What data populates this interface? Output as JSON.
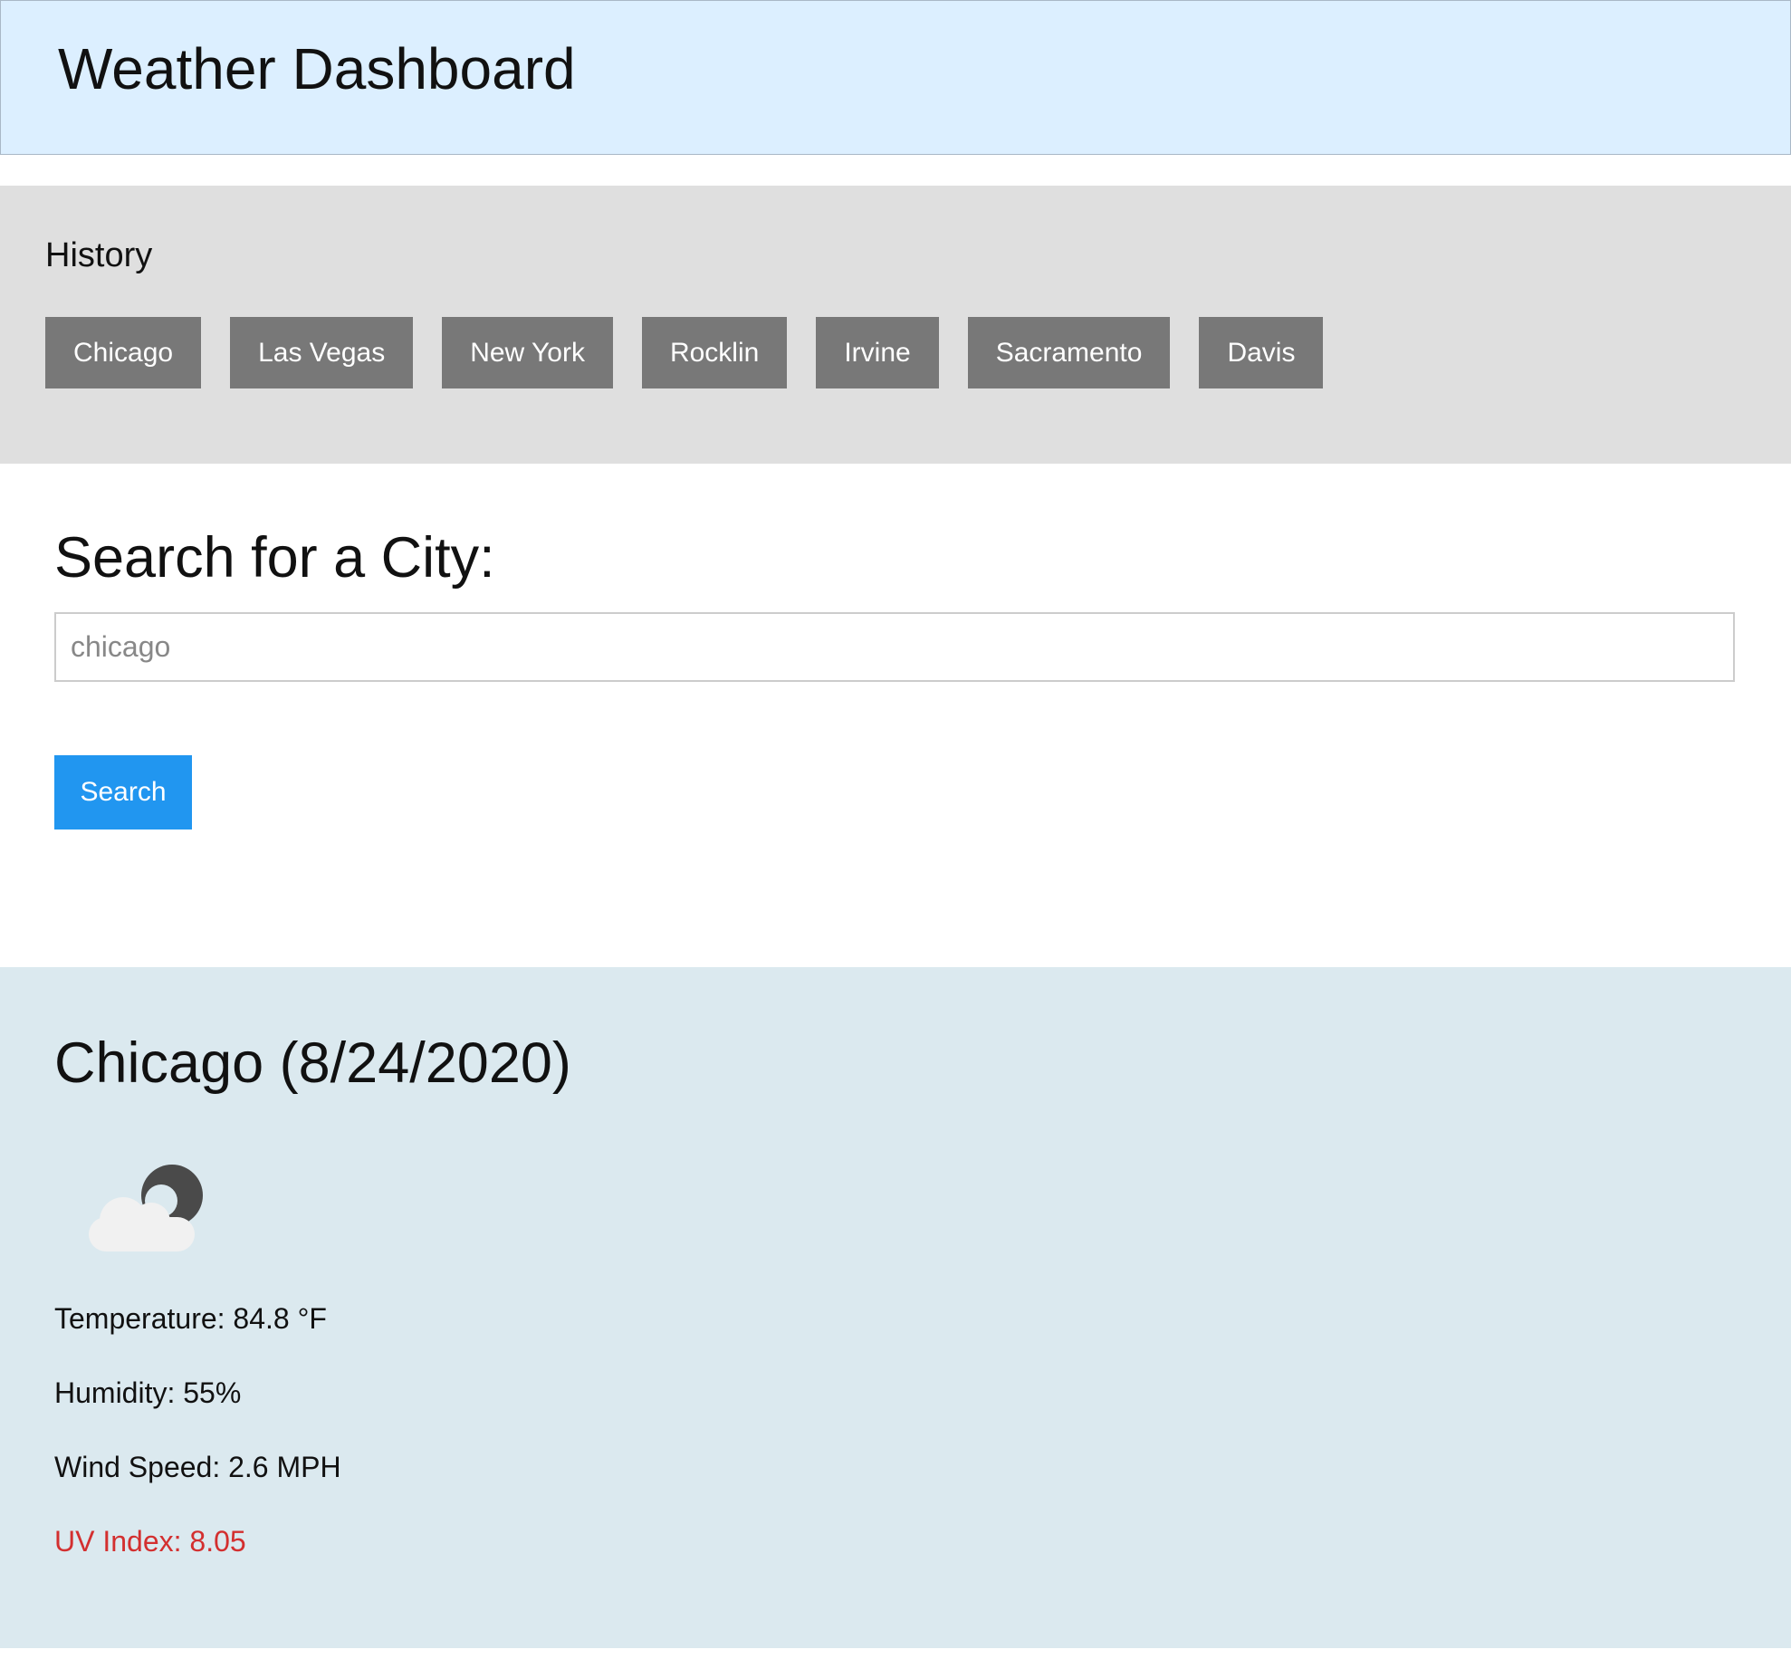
{
  "header": {
    "title": "Weather Dashboard"
  },
  "history": {
    "title": "History",
    "items": [
      "Chicago",
      "Las Vegas",
      "New York",
      "Rocklin",
      "Irvine",
      "Sacramento",
      "Davis"
    ]
  },
  "search": {
    "title": "Search for a City:",
    "placeholder": "chicago",
    "value": "",
    "button_label": "Search",
    "button_color": "#2196f0"
  },
  "weather": {
    "title": "Chicago (8/24/2020)",
    "icon": "partly-cloudy-night-icon",
    "temperature": "Temperature: 84.8 °F",
    "humidity": "Humidity: 55%",
    "wind_speed": "Wind Speed: 2.6 MPH",
    "uv_index": "UV Index: 8.05",
    "uv_color": "#d32f2f"
  },
  "colors": {
    "header_bg": "#dcefff",
    "history_bg": "#dfdfdf",
    "history_button_bg": "#787878",
    "weather_bg": "#dbe9ef"
  }
}
